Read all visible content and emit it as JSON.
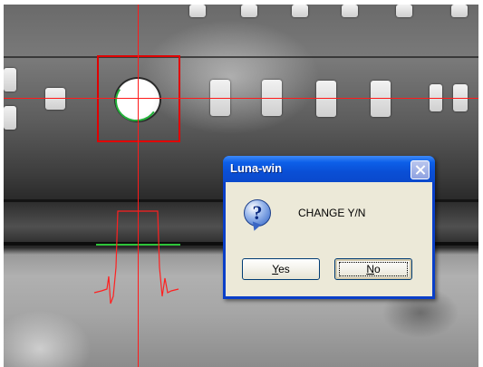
{
  "dialog": {
    "title": "Luna-win",
    "message": "CHANGE Y/N",
    "yes_label": "Yes",
    "no_label": "No",
    "icon": "question-icon"
  },
  "overlay": {
    "crosshair_color": "#ff1a1a",
    "target_box_color": "#e00000",
    "edge_marker_color": "#2ec43a"
  }
}
